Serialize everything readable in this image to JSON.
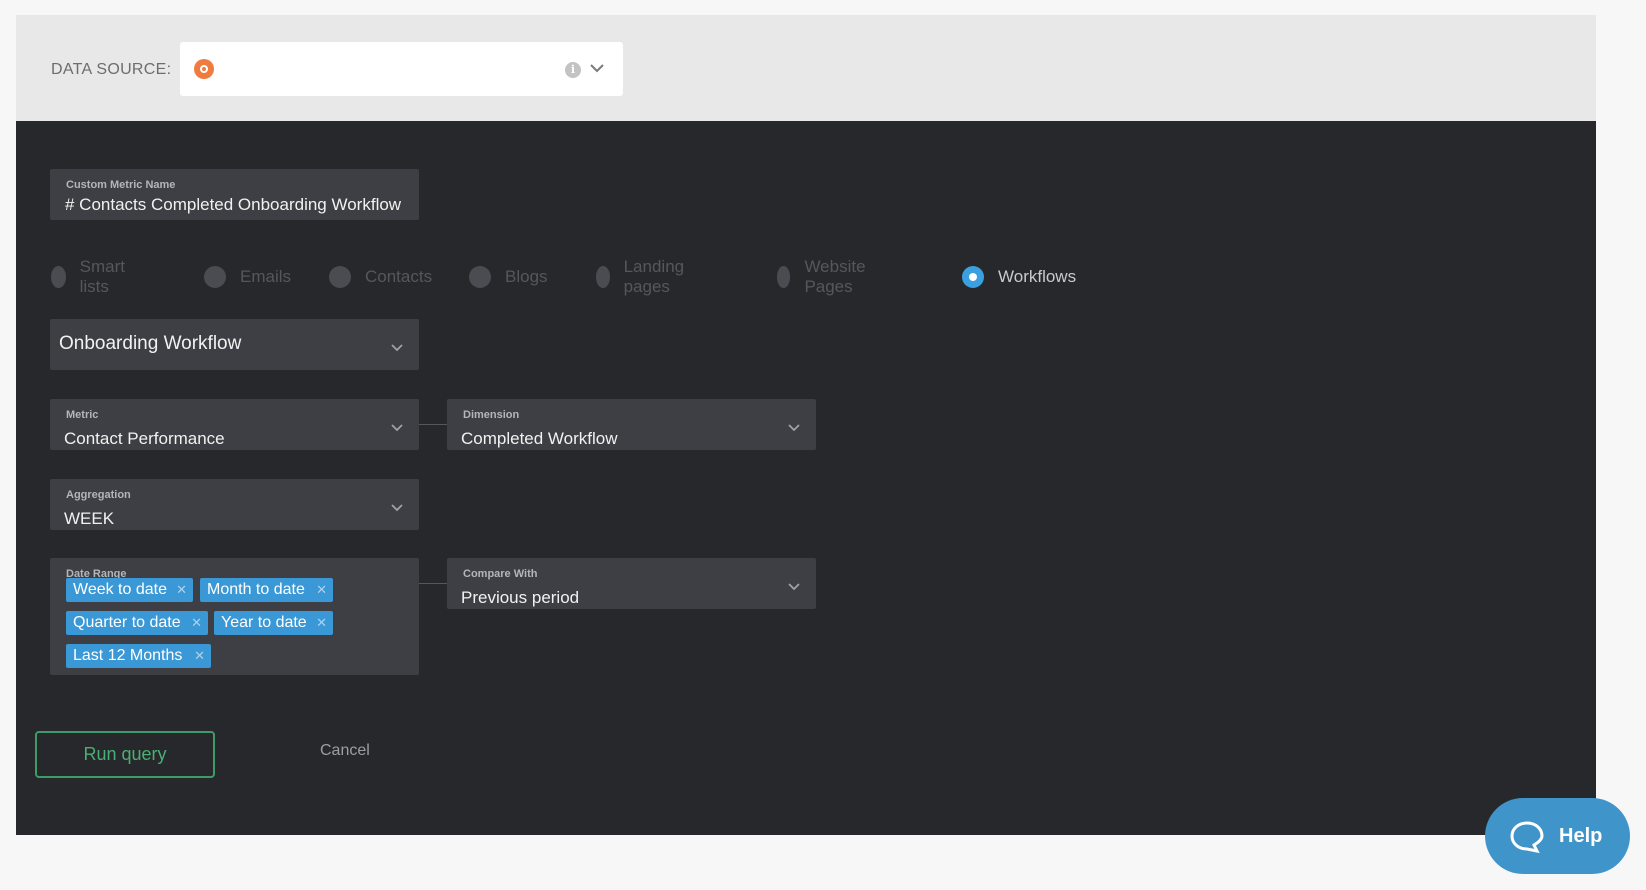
{
  "data_source": {
    "label": "DATA SOURCE:",
    "selected_icon": "hubspot-icon",
    "info_icon": "info-icon"
  },
  "metric_name": {
    "label": "Custom Metric Name",
    "value": "# Contacts Completed Onboarding Workflow"
  },
  "object_types": [
    {
      "label": "Smart lists",
      "selected": false
    },
    {
      "label": "Emails",
      "selected": false
    },
    {
      "label": "Contacts",
      "selected": false
    },
    {
      "label": "Blogs",
      "selected": false
    },
    {
      "label": "Landing pages",
      "selected": false
    },
    {
      "label": "Website Pages",
      "selected": false
    },
    {
      "label": "Workflows",
      "selected": true
    }
  ],
  "workflow_select": {
    "value": "Onboarding Workflow"
  },
  "metric": {
    "label": "Metric",
    "value": "Contact Performance"
  },
  "dimension": {
    "label": "Dimension",
    "value": "Completed Workflow"
  },
  "aggregation": {
    "label": "Aggregation",
    "value": "WEEK"
  },
  "date_range": {
    "label": "Date Range",
    "chips": [
      "Week to date",
      "Month to date",
      "Quarter to date",
      "Year to date",
      "Last 12 Months"
    ]
  },
  "compare_with": {
    "label": "Compare With",
    "value": "Previous period"
  },
  "actions": {
    "run_label": "Run query",
    "cancel_label": "Cancel"
  },
  "help": {
    "label": "Help"
  },
  "colors": {
    "panel_bg": "#26282c",
    "field_bg": "#3d3f44",
    "accent_blue": "#3a98d6",
    "run_green": "#4cae74",
    "help_blue": "#3f95c9"
  }
}
